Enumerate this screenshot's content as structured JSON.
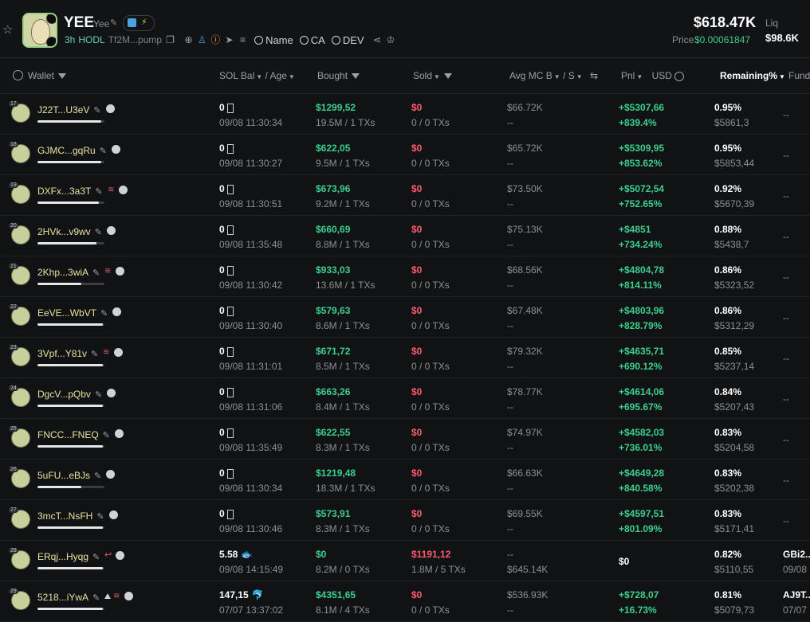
{
  "token": {
    "symbol": "YEE",
    "name": "Yee",
    "age": "3h",
    "hodl": "HODL",
    "address": "Tf2M...pump",
    "search_name": "Name",
    "search_ca": "CA",
    "search_dev": "DEV",
    "market_cap": "$618.47K",
    "price_label": "Price",
    "price": "$0.00061847",
    "liq_label": "Liq",
    "liq": "$98.6K"
  },
  "columns": {
    "wallet": "Wallet",
    "sol_bal": "SOL Bal",
    "age": "/ Age",
    "bought": "Bought",
    "sold": "Sold",
    "avg_mc": "Avg MC B",
    "avg_mc_s": "/ S",
    "pnl": "Pnl",
    "usd": "USD",
    "remaining": "Remaining%",
    "fund": "Fund"
  },
  "rows": [
    {
      "num": "17",
      "wallet": "J22T...U3eV",
      "icons": "d",
      "bar": 0.95,
      "sol": "0",
      "time": "09/08 11:30:34",
      "bought": "$1299,52",
      "bought_sub": "19.5M / 1 TXs",
      "sold": "$0",
      "sold_sub": "0 / 0 TXs",
      "mc": "$66.72K",
      "mc_sub": "--",
      "pnl": "+$5307,66",
      "pnl_sub": "+839.4%",
      "rem": "0.95%",
      "rem_sub": "$5861,3",
      "fund": "--",
      "fund_sub": ""
    },
    {
      "num": "18",
      "wallet": "GJMC...gqRu",
      "icons": "d",
      "bar": 0.95,
      "sol": "0",
      "time": "09/08 11:30:27",
      "bought": "$622,05",
      "bought_sub": "9.5M / 1 TXs",
      "sold": "$0",
      "sold_sub": "0 / 0 TXs",
      "mc": "$65.72K",
      "mc_sub": "--",
      "pnl": "+$5309,95",
      "pnl_sub": "+853.62%",
      "rem": "0.95%",
      "rem_sub": "$5853,44",
      "fund": "--",
      "fund_sub": ""
    },
    {
      "num": "19",
      "wallet": "DXFx...3a3T",
      "icons": "ld",
      "bar": 0.92,
      "sol": "0",
      "time": "09/08 11:30:51",
      "bought": "$673,96",
      "bought_sub": "9.2M / 1 TXs",
      "sold": "$0",
      "sold_sub": "0 / 0 TXs",
      "mc": "$73.50K",
      "mc_sub": "--",
      "pnl": "+$5072,54",
      "pnl_sub": "+752.65%",
      "rem": "0.92%",
      "rem_sub": "$5670,39",
      "fund": "--",
      "fund_sub": ""
    },
    {
      "num": "20",
      "wallet": "2HVk...v9wv",
      "icons": "d",
      "bar": 0.88,
      "sol": "0",
      "time": "09/08 11:35:48",
      "bought": "$660,69",
      "bought_sub": "8.8M / 1 TXs",
      "sold": "$0",
      "sold_sub": "0 / 0 TXs",
      "mc": "$75.13K",
      "mc_sub": "--",
      "pnl": "+$4851",
      "pnl_sub": "+734.24%",
      "rem": "0.88%",
      "rem_sub": "$5438,7",
      "fund": "--",
      "fund_sub": ""
    },
    {
      "num": "21",
      "wallet": "2Khp...3wiA",
      "icons": "ld",
      "bar": 0.65,
      "sol": "0",
      "time": "09/08 11:30:42",
      "bought": "$933,03",
      "bought_sub": "13.6M / 1 TXs",
      "sold": "$0",
      "sold_sub": "0 / 0 TXs",
      "mc": "$68.56K",
      "mc_sub": "--",
      "pnl": "+$4804,78",
      "pnl_sub": "+814.11%",
      "rem": "0.86%",
      "rem_sub": "$5323,52",
      "fund": "--",
      "fund_sub": ""
    },
    {
      "num": "22",
      "wallet": "EeVE...WbVT",
      "icons": "d",
      "bar": 0.98,
      "sol": "0",
      "time": "09/08 11:30:40",
      "bought": "$579,63",
      "bought_sub": "8.6M / 1 TXs",
      "sold": "$0",
      "sold_sub": "0 / 0 TXs",
      "mc": "$67.48K",
      "mc_sub": "--",
      "pnl": "+$4803,96",
      "pnl_sub": "+828.79%",
      "rem": "0.86%",
      "rem_sub": "$5312,29",
      "fund": "--",
      "fund_sub": ""
    },
    {
      "num": "23",
      "wallet": "3Vpf...Y81v",
      "icons": "ld",
      "bar": 0.98,
      "sol": "0",
      "time": "09/08 11:31:01",
      "bought": "$671,72",
      "bought_sub": "8.5M / 1 TXs",
      "sold": "$0",
      "sold_sub": "0 / 0 TXs",
      "mc": "$79.32K",
      "mc_sub": "--",
      "pnl": "+$4635,71",
      "pnl_sub": "+690.12%",
      "rem": "0.85%",
      "rem_sub": "$5237,14",
      "fund": "--",
      "fund_sub": ""
    },
    {
      "num": "24",
      "wallet": "DgcV...pQbv",
      "icons": "d",
      "bar": 0.98,
      "sol": "0",
      "time": "09/08 11:31:06",
      "bought": "$663,26",
      "bought_sub": "8.4M / 1 TXs",
      "sold": "$0",
      "sold_sub": "0 / 0 TXs",
      "mc": "$78.77K",
      "mc_sub": "--",
      "pnl": "+$4614,06",
      "pnl_sub": "+695.67%",
      "rem": "0.84%",
      "rem_sub": "$5207,43",
      "fund": "--",
      "fund_sub": ""
    },
    {
      "num": "25",
      "wallet": "FNCC...FNEQ",
      "icons": "d",
      "bar": 0.98,
      "sol": "0",
      "time": "09/08 11:35:49",
      "bought": "$622,55",
      "bought_sub": "8.3M / 1 TXs",
      "sold": "$0",
      "sold_sub": "0 / 0 TXs",
      "mc": "$74.97K",
      "mc_sub": "--",
      "pnl": "+$4582,03",
      "pnl_sub": "+736.01%",
      "rem": "0.83%",
      "rem_sub": "$5204,58",
      "fund": "--",
      "fund_sub": ""
    },
    {
      "num": "26",
      "wallet": "5uFU...eBJs",
      "icons": "d",
      "bar": 0.65,
      "sol": "0",
      "time": "09/08 11:30:34",
      "bought": "$1219,48",
      "bought_sub": "18.3M / 1 TXs",
      "sold": "$0",
      "sold_sub": "0 / 0 TXs",
      "mc": "$66.63K",
      "mc_sub": "--",
      "pnl": "+$4649,28",
      "pnl_sub": "+840.58%",
      "rem": "0.83%",
      "rem_sub": "$5202,38",
      "fund": "--",
      "fund_sub": ""
    },
    {
      "num": "27",
      "wallet": "3mcT...NsFH",
      "icons": "d",
      "bar": 0.98,
      "sol": "0",
      "time": "09/08 11:30:46",
      "bought": "$573,91",
      "bought_sub": "8.3M / 1 TXs",
      "sold": "$0",
      "sold_sub": "0 / 0 TXs",
      "mc": "$69.55K",
      "mc_sub": "--",
      "pnl": "+$4597,51",
      "pnl_sub": "+801.09%",
      "rem": "0.83%",
      "rem_sub": "$5171,41",
      "fund": "--",
      "fund_sub": ""
    },
    {
      "num": "28",
      "wallet": "ERqj...Hyqg",
      "icons": "ad",
      "bar": 0.98,
      "sol": "5.58",
      "sol_emoji": "🐟",
      "time": "09/08 14:15:49",
      "bought": "$0",
      "bought_sub": "8.2M / 0 TXs",
      "sold": "$1191,12",
      "sold_sub": "1.8M / 5 TXs",
      "mc": "--",
      "mc_sub": "$645.14K",
      "pnl": "$0",
      "pnl_sub": "",
      "rem": "0.82%",
      "rem_sub": "$5110,55",
      "fund": "GBi2...",
      "fund_sub": "09/08"
    },
    {
      "num": "29",
      "wallet": "5218...iYwA",
      "icons": "tld",
      "bar": 0.98,
      "sol": "147,15",
      "sol_emoji": "🐬",
      "time": "07/07 13:37:02",
      "bought": "$4351,65",
      "bought_sub": "8.1M / 4 TXs",
      "sold": "$0",
      "sold_sub": "0 / 0 TXs",
      "mc": "$536.93K",
      "mc_sub": "--",
      "pnl": "+$728,07",
      "pnl_sub": "+16.73%",
      "rem": "0.81%",
      "rem_sub": "$5079,73",
      "fund": "AJ9T...",
      "fund_sub": "07/07"
    }
  ]
}
